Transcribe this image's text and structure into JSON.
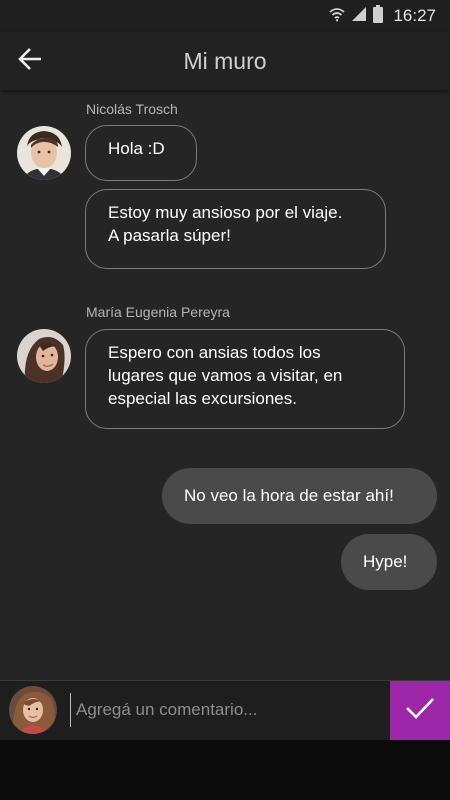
{
  "status_bar": {
    "time": "16:27",
    "icons": [
      "wifi-icon",
      "signal-icon",
      "battery-icon"
    ]
  },
  "header": {
    "title": "Mi muro",
    "back_icon": "arrow-left-icon"
  },
  "messages": [
    {
      "sender": "Nicolás Trosch",
      "avatar": "avatar-nicolas",
      "bubbles": [
        "Hola :D",
        "Estoy muy ansioso por el viaje.\nA pasarla súper!"
      ]
    },
    {
      "sender": "María Eugenia Pereyra",
      "avatar": "avatar-maria",
      "bubbles": [
        "Espero con ansias todos los\nlugares que vamos a visitar, en\nespecial las excursiones."
      ]
    },
    {
      "sender": "",
      "outgoing": true,
      "bubbles": [
        "No veo la hora de estar ahí!",
        "Hype!"
      ]
    }
  ],
  "composer": {
    "placeholder": "Agregá un comentario...",
    "send_icon": "checkmark-icon"
  },
  "colors": {
    "background": "#252525",
    "app_bar": "#222222",
    "accent": "#9c27a8",
    "outgoing_bubble": "#4a4a4a",
    "incoming_bubble_border": "#7c7c7c"
  }
}
